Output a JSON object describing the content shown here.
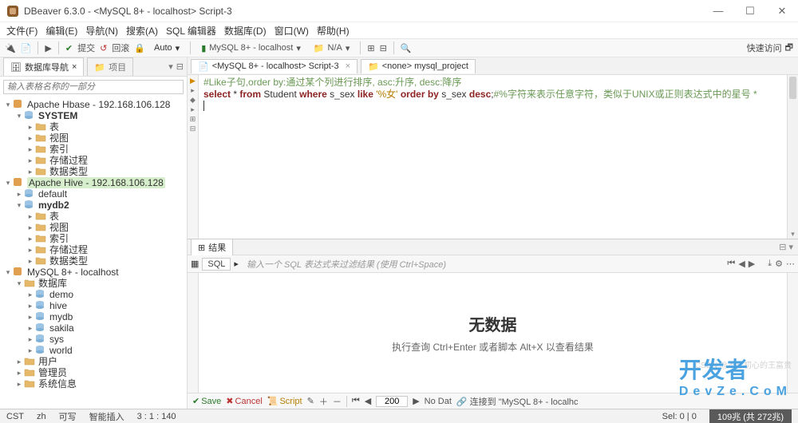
{
  "title": "DBeaver 6.3.0 - <MySQL 8+ - localhost> Script-3",
  "menus": [
    "文件(F)",
    "编辑(E)",
    "导航(N)",
    "搜索(A)",
    "SQL 编辑器",
    "数据库(D)",
    "窗口(W)",
    "帮助(H)"
  ],
  "toolbar": {
    "commit": "提交",
    "rollback": "回滚",
    "auto": "Auto",
    "connection": "MySQL 8+ - localhost",
    "schema": "N/A",
    "quick": "快速访问"
  },
  "sidebar": {
    "tab1": "数据库导航",
    "tab2": "项目",
    "filter_placeholder": "输入表格名称的一部分",
    "nodes": [
      {
        "d": 0,
        "t": "v",
        "ic": "hbase",
        "lbl": "Apache Hbase - 192.168.106.128"
      },
      {
        "d": 1,
        "t": "v",
        "ic": "db",
        "lbl": "SYSTEM",
        "bold": true
      },
      {
        "d": 2,
        "t": ">",
        "ic": "fld",
        "lbl": "表"
      },
      {
        "d": 2,
        "t": ">",
        "ic": "fld",
        "lbl": "视图"
      },
      {
        "d": 2,
        "t": ">",
        "ic": "fld",
        "lbl": "索引"
      },
      {
        "d": 2,
        "t": ">",
        "ic": "fld",
        "lbl": "存储过程"
      },
      {
        "d": 2,
        "t": ">",
        "ic": "fld",
        "lbl": "数据类型"
      },
      {
        "d": 0,
        "t": "v",
        "ic": "hive",
        "lbl": "Apache Hive - 192.168.106.128",
        "hl": true
      },
      {
        "d": 1,
        "t": ">",
        "ic": "db",
        "lbl": "default"
      },
      {
        "d": 1,
        "t": "v",
        "ic": "db",
        "lbl": "mydb2",
        "bold": true
      },
      {
        "d": 2,
        "t": ">",
        "ic": "fld",
        "lbl": "表"
      },
      {
        "d": 2,
        "t": ">",
        "ic": "fld",
        "lbl": "视图"
      },
      {
        "d": 2,
        "t": ">",
        "ic": "fld",
        "lbl": "索引"
      },
      {
        "d": 2,
        "t": ">",
        "ic": "fld",
        "lbl": "存储过程"
      },
      {
        "d": 2,
        "t": ">",
        "ic": "fld",
        "lbl": "数据类型"
      },
      {
        "d": 0,
        "t": "v",
        "ic": "mysql",
        "lbl": "MySQL 8+ - localhost"
      },
      {
        "d": 1,
        "t": "v",
        "ic": "fld",
        "lbl": "数据库"
      },
      {
        "d": 2,
        "t": ">",
        "ic": "db",
        "lbl": "demo"
      },
      {
        "d": 2,
        "t": ">",
        "ic": "db",
        "lbl": "hive"
      },
      {
        "d": 2,
        "t": ">",
        "ic": "db",
        "lbl": "mydb"
      },
      {
        "d": 2,
        "t": ">",
        "ic": "db",
        "lbl": "sakila"
      },
      {
        "d": 2,
        "t": ">",
        "ic": "db",
        "lbl": "sys"
      },
      {
        "d": 2,
        "t": ">",
        "ic": "db",
        "lbl": "world"
      },
      {
        "d": 1,
        "t": ">",
        "ic": "fld",
        "lbl": "用户"
      },
      {
        "d": 1,
        "t": ">",
        "ic": "fld",
        "lbl": "管理员"
      },
      {
        "d": 1,
        "t": ">",
        "ic": "fld",
        "lbl": "系统信息"
      }
    ]
  },
  "editor": {
    "tab1": "<MySQL 8+ - localhost> Script-3",
    "tab2": "<none> mysql_project",
    "line1_pre": "#Like子句,order by:通过某个列进行排序, asc:升序, desc:降序",
    "line2_comment": "#%字符来表示任意字符，类似于UNIX或正则表达式中的星号 *",
    "sql": {
      "select": "select",
      "star": "*",
      "from": "from",
      "tbl": "Student",
      "where": "where",
      "col": "s_sex",
      "like": "like",
      "lit": "'%女'",
      "order": "order by",
      "col2": "s_sex",
      "desc": "desc"
    }
  },
  "results": {
    "tab": "结果",
    "sql_badge": "SQL",
    "filter_placeholder": "输入一个 SQL 表达式来过滤结果 (使用 Ctrl+Space)",
    "nodata": "无数据",
    "nodata_sub": "执行查询 Ctrl+Enter 或者脚本 Alt+X 以查看结果"
  },
  "res_bottom": {
    "save": "Save",
    "cancel": "Cancel",
    "script": "Script",
    "rows": "200",
    "nodate": "No Dat",
    "conn": "连接到 \"MySQL 8+ - localhc"
  },
  "status": {
    "cst": "CST",
    "lang": "zh",
    "write": "可写",
    "insert": "智能插入",
    "pos": "3 : 1 : 140",
    "sel": "Sel: 0 | 0",
    "heap": "109兆 (共 272兆)"
  },
  "watermark": {
    "big": "开发者",
    "small": "DevZe.CoM"
  }
}
